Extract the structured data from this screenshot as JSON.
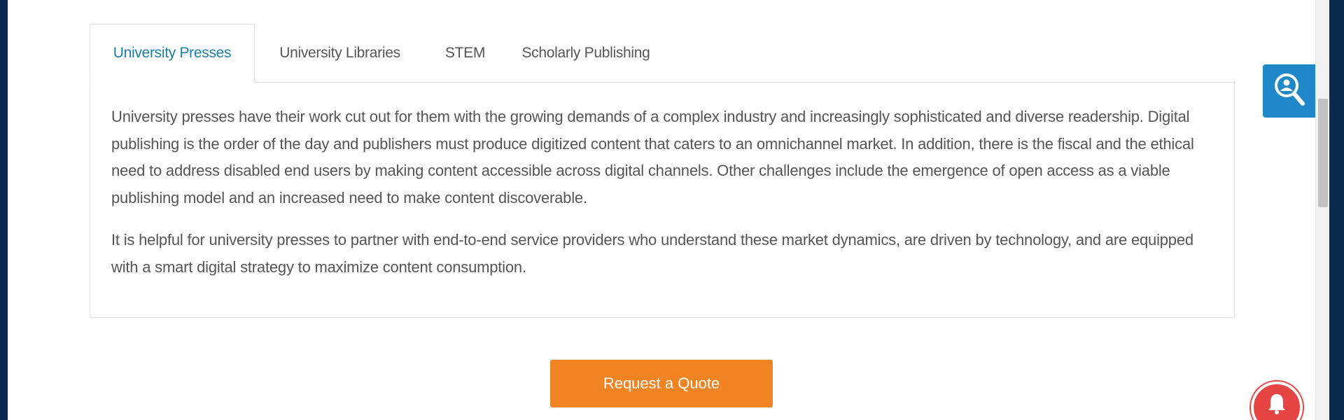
{
  "tabs": [
    {
      "label": "University Presses",
      "active": true
    },
    {
      "label": "University Libraries",
      "active": false
    },
    {
      "label": "STEM",
      "active": false
    },
    {
      "label": "Scholarly Publishing",
      "active": false
    }
  ],
  "panel": {
    "paragraphs": [
      "University presses have their work cut out for them with the growing demands of a complex industry and increasingly sophisticated and diverse readership. Digital publishing is the order of the day and publishers must produce digitized content that caters to an omnichannel market. In addition, there is the fiscal and the ethical need to address disabled end users by making content accessible across digital channels. Other challenges include the emergence of open access as a viable publishing model and an increased need to make content discoverable.",
      "It is helpful for university presses to partner with end-to-end service providers who understand these market dynamics, are driven by technology, and are equipped with a smart digital strategy to maximize content consumption."
    ]
  },
  "cta": {
    "label": "Request a Quote"
  },
  "colors": {
    "active_tab": "#1a7fa0",
    "button": "#f28322",
    "search_widget": "#1e88c9",
    "notification": "#e64543"
  },
  "icons": {
    "search_widget": "person-search-icon",
    "notification": "bell-icon"
  }
}
